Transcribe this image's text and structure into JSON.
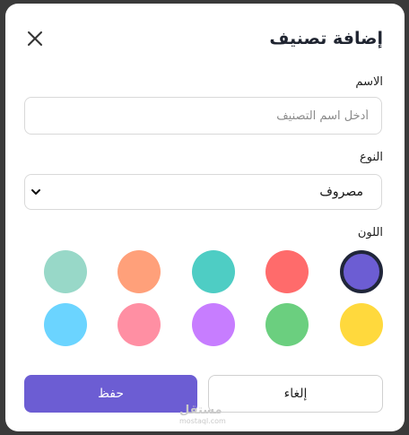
{
  "dialog": {
    "title": "إضافة تصنيف",
    "close_icon": "close-icon"
  },
  "fields": {
    "name": {
      "label": "الاسم",
      "placeholder": "أدخل اسم التصنيف",
      "value": ""
    },
    "type": {
      "label": "النوع",
      "selected": "مصروف",
      "chevron_icon": "chevron-down-icon"
    },
    "color": {
      "label": "اللون",
      "selected_index": 0,
      "swatches": [
        "#6c5dd3",
        "#ff6b6b",
        "#4ecdc4",
        "#ffa07a",
        "#98d8c8",
        "#ffd93d",
        "#6bcf7f",
        "#c77dff",
        "#ff8fa3",
        "#6bd4ff"
      ]
    }
  },
  "buttons": {
    "save": "حفظ",
    "cancel": "إلغاء"
  },
  "watermark": {
    "line1": "مستقل",
    "line2": "mostaql.com"
  },
  "colors": {
    "accent": "#6c5dd3"
  }
}
